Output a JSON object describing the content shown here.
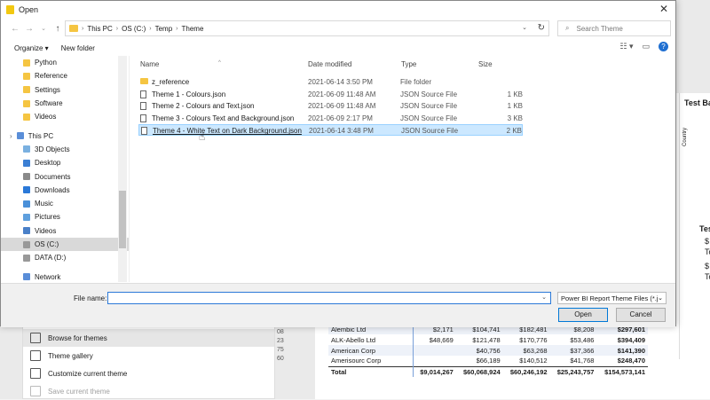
{
  "dialog": {
    "title": "Open",
    "breadcrumb": [
      "This PC",
      "OS (C:)",
      "Temp",
      "Theme"
    ],
    "search_placeholder": "Search Theme",
    "toolbar": {
      "organize": "Organize ▾",
      "new_folder": "New folder"
    },
    "sidebar": [
      {
        "label": "Python",
        "icon": "folder-icon"
      },
      {
        "label": "Reference",
        "icon": "folder-icon"
      },
      {
        "label": "Settings",
        "icon": "folder-icon"
      },
      {
        "label": "Software",
        "icon": "folder-icon"
      },
      {
        "label": "Videos",
        "icon": "folder-icon"
      },
      {
        "label": "This PC",
        "icon": "computer-icon"
      },
      {
        "label": "3D Objects",
        "icon": "cube-icon"
      },
      {
        "label": "Desktop",
        "icon": "desktop-icon"
      },
      {
        "label": "Documents",
        "icon": "documents-icon"
      },
      {
        "label": "Downloads",
        "icon": "download-icon"
      },
      {
        "label": "Music",
        "icon": "music-icon"
      },
      {
        "label": "Pictures",
        "icon": "pictures-icon"
      },
      {
        "label": "Videos",
        "icon": "videos-icon"
      },
      {
        "label": "OS (C:)",
        "icon": "drive-icon"
      },
      {
        "label": "DATA (D:)",
        "icon": "drive-icon"
      },
      {
        "label": "Network",
        "icon": "network-icon"
      }
    ],
    "columns": {
      "name": "Name",
      "date": "Date modified",
      "type": "Type",
      "size": "Size"
    },
    "files": [
      {
        "name": "z_reference",
        "date": "2021-06-14 3:50 PM",
        "type": "File folder",
        "size": ""
      },
      {
        "name": "Theme 1 - Colours.json",
        "date": "2021-06-09 11:48 AM",
        "type": "JSON Source File",
        "size": "1 KB"
      },
      {
        "name": "Theme 2 - Colours and Text.json",
        "date": "2021-06-09 11:48 AM",
        "type": "JSON Source File",
        "size": "1 KB"
      },
      {
        "name": "Theme 3 - Colours Text and Background.json",
        "date": "2021-06-09 2:17 PM",
        "type": "JSON Source File",
        "size": "3 KB"
      },
      {
        "name": "Theme 4 - White Text on Dark Background.json",
        "date": "2021-06-14 3:48 PM",
        "type": "JSON Source File",
        "size": "2 KB"
      }
    ],
    "file_name_label": "File name:",
    "file_name_value": "",
    "filter": "Power BI Report Theme Files (*.j",
    "open": "Open",
    "cancel": "Cancel"
  },
  "background": {
    "panel_title_1": "Test Ba",
    "panel_title_2": "Tes",
    "panel_axis": "Country",
    "panel_values": [
      "$",
      "To",
      "$",
      "To"
    ],
    "theme_menu": [
      "Browse for themes",
      "Theme gallery",
      "Customize current theme",
      "Save current theme"
    ],
    "menu_side_numbers": [
      "08",
      "23",
      "75",
      "60"
    ],
    "table_rows": [
      [
        "Alembic Ltd",
        "$2,171",
        "$104,741",
        "$182,481",
        "$8,208",
        "$297,601"
      ],
      [
        "ALK-Abello Ltd",
        "$48,669",
        "$121,478",
        "$170,776",
        "$53,486",
        "$394,409"
      ],
      [
        "American Corp",
        "",
        "$40,756",
        "$63,268",
        "$37,366",
        "$141,390"
      ],
      [
        "Amerisourc Corp",
        "",
        "$66,189",
        "$140,512",
        "$41,768",
        "$248,470"
      ]
    ],
    "table_total": [
      "Total",
      "$9,014,267",
      "$60,068,924",
      "$60,246,192",
      "$25,243,757",
      "$154,573,141"
    ]
  },
  "colors": {
    "accent": "#0078d7",
    "selection": "#cce8ff",
    "folder": "#f5c542"
  }
}
